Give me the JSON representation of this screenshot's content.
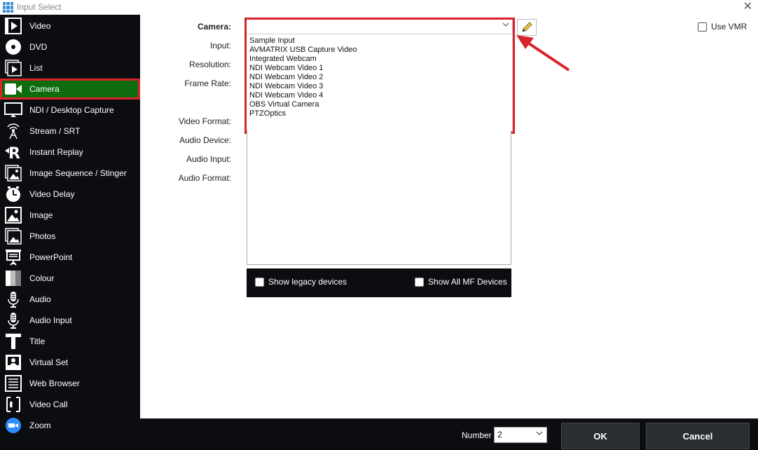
{
  "window": {
    "title": "Input Select",
    "close_label": "✕"
  },
  "sidebar": {
    "items": [
      {
        "label": "Video",
        "icon": "video-file-icon"
      },
      {
        "label": "DVD",
        "icon": "disc-icon"
      },
      {
        "label": "List",
        "icon": "list-icon"
      },
      {
        "label": "Camera",
        "icon": "camera-icon",
        "selected": true
      },
      {
        "label": "NDI / Desktop Capture",
        "icon": "monitor-icon"
      },
      {
        "label": "Stream / SRT",
        "icon": "antenna-icon"
      },
      {
        "label": "Instant Replay",
        "icon": "replay-icon"
      },
      {
        "label": "Image Sequence / Stinger",
        "icon": "image-sequence-icon"
      },
      {
        "label": "Video Delay",
        "icon": "clock-icon"
      },
      {
        "label": "Image",
        "icon": "image-icon"
      },
      {
        "label": "Photos",
        "icon": "photos-icon"
      },
      {
        "label": "PowerPoint",
        "icon": "presentation-icon"
      },
      {
        "label": "Colour",
        "icon": "colour-icon"
      },
      {
        "label": "Audio",
        "icon": "microphone-icon"
      },
      {
        "label": "Audio Input",
        "icon": "microphone-icon"
      },
      {
        "label": "Title",
        "icon": "title-icon"
      },
      {
        "label": "Virtual Set",
        "icon": "virtual-set-icon"
      },
      {
        "label": "Web Browser",
        "icon": "web-browser-icon"
      },
      {
        "label": "Video Call",
        "icon": "video-call-icon"
      },
      {
        "label": "Zoom",
        "icon": "zoom-icon"
      }
    ]
  },
  "form": {
    "camera_label": "Camera:",
    "input_label": "Input:",
    "resolution_label": "Resolution:",
    "frame_rate_label": "Frame Rate:",
    "video_format_label": "Video Format:",
    "audio_device_label": "Audio Device:",
    "audio_input_label": "Audio Input:",
    "audio_format_label": "Audio Format:",
    "camera_value": ""
  },
  "camera_options": [
    "Sample Input",
    "AVMATRIX USB Capture Video",
    "Integrated Webcam",
    "NDI Webcam Video 1",
    "NDI Webcam Video 2",
    "NDI Webcam Video 3",
    "NDI Webcam Video 4",
    "OBS Virtual Camera",
    "PTZOptics"
  ],
  "options": {
    "use_vmr_label": "Use VMR",
    "show_legacy_label": "Show legacy devices",
    "show_all_mf_label": "Show All MF Devices"
  },
  "footer": {
    "number_label": "Number",
    "number_value": "2",
    "ok_label": "OK",
    "cancel_label": "Cancel"
  },
  "colors": {
    "selected_bg": "#0e6b0e",
    "highlight_red": "#d8242a",
    "dark_bg": "#0b0d10"
  }
}
